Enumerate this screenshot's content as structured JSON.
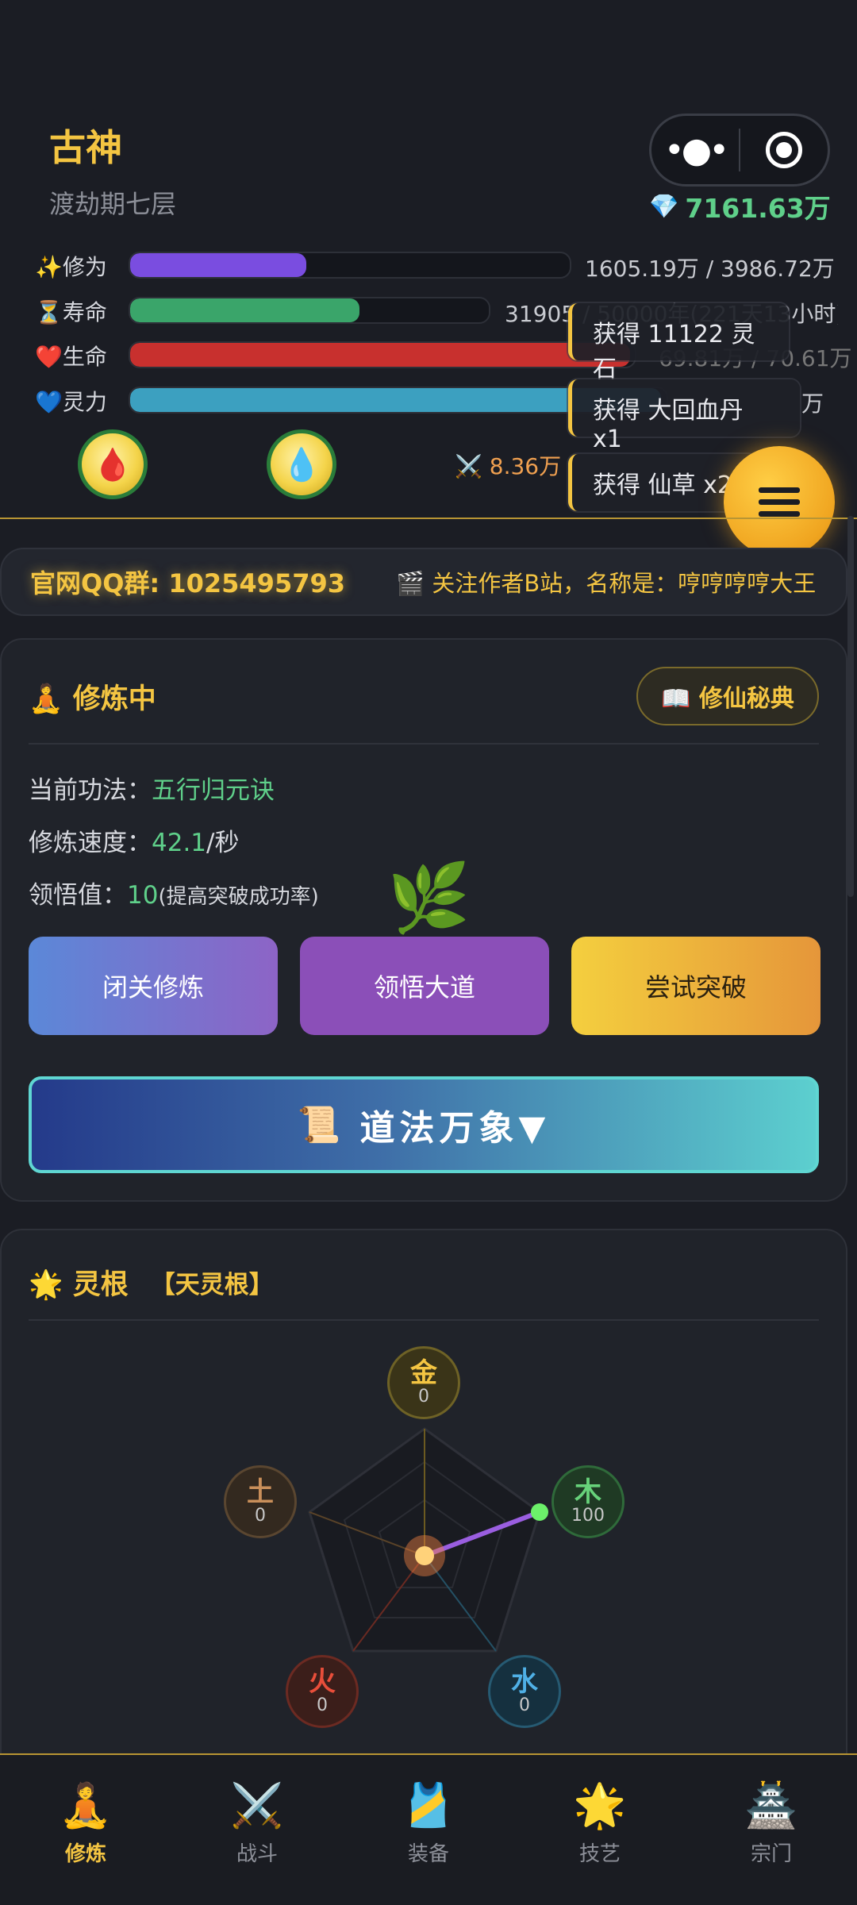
{
  "header": {
    "name": "古神",
    "realm": "渡劫期七层",
    "capsule": {
      "more_icon": "more-dots-icon",
      "close_icon": "target-icon"
    },
    "spirit_stones": "7161.63万",
    "gem_icon": "gem-icon"
  },
  "stats": [
    {
      "icon": "sparkles-icon",
      "label": "✨修为",
      "value": "1605.19万 / 3986.72万",
      "fill": 0.4,
      "color": "#7a4de0"
    },
    {
      "icon": "hourglass-icon",
      "label": "⏳寿命",
      "value": "31905 / 50000年(221天13小时)",
      "fill": 0.64,
      "color": "#3aa56a"
    },
    {
      "icon": "heart-icon",
      "label": "❤️生命",
      "value": "69.81万 / 70.61万",
      "fill": 0.99,
      "color": "#c8302e"
    },
    {
      "icon": "blue-heart-icon",
      "label": "💙灵力",
      "value": "万",
      "fill": 0.99,
      "color": "#3ca0c0"
    }
  ],
  "combat_power": "⚔️ 8.36万",
  "orbs": {
    "hp": "blood-drop-icon",
    "mp": "water-drop-icon"
  },
  "toasts": [
    "获得 11122 灵石",
    "获得 大回血丹 x1",
    "获得 仙草 x2"
  ],
  "marquee": {
    "qq": "官网QQ群: 1025495793",
    "bilibili": "🎬 关注作者B站，名称是：哼哼哼哼大王"
  },
  "cultivation": {
    "title": "🧘 修炼中",
    "manual_button": "📖 修仙秘典",
    "technique_label": "当前功法：",
    "technique_value": "五行归元诀",
    "speed_label": "修炼速度：",
    "speed_value": "42.1",
    "speed_unit": "/秒",
    "insight_label": "领悟值：",
    "insight_value": "10",
    "insight_note": "(提高突破成功率)",
    "buttons": {
      "closed": "闭关修炼",
      "enlighten": "领悟大道",
      "breakthrough": "尝试突破"
    },
    "dao_button": "道法万象▼"
  },
  "spirit_root": {
    "title": "🌟 灵根",
    "type": "【天灵根】",
    "elements": [
      {
        "name": "金",
        "value": 0
      },
      {
        "name": "木",
        "value": 100
      },
      {
        "name": "水",
        "value": 0
      },
      {
        "name": "火",
        "value": 0
      },
      {
        "name": "土",
        "value": 0
      }
    ]
  },
  "nav": [
    {
      "label": "修炼",
      "icon": "🧘",
      "active": true
    },
    {
      "label": "战斗",
      "icon": "⚔️",
      "active": false
    },
    {
      "label": "装备",
      "icon": "🎽",
      "active": false
    },
    {
      "label": "技艺",
      "icon": "🌟",
      "active": false
    },
    {
      "label": "宗门",
      "icon": "🏯",
      "active": false
    }
  ]
}
